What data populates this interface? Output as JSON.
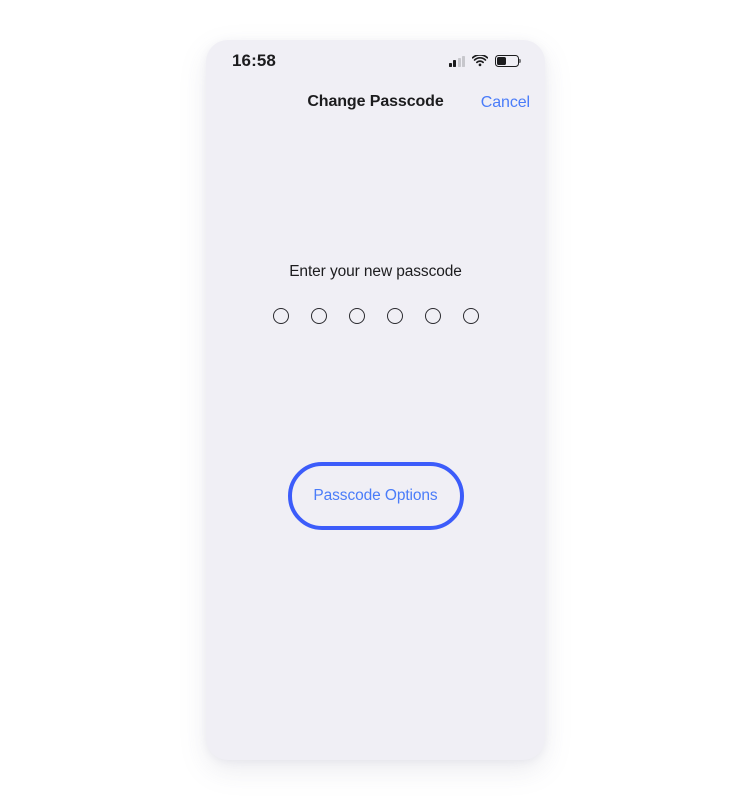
{
  "screen": {
    "background_color": "#ffffff",
    "panel_color": "#f0eff5"
  },
  "status_bar": {
    "time": "16:58",
    "cellular": {
      "icon": "cellular-signal-icon",
      "bars_total": 4,
      "bars_active": 2
    },
    "wifi": {
      "icon": "wifi-icon",
      "strength": "full"
    },
    "battery": {
      "icon": "battery-icon",
      "level_percent": 45
    }
  },
  "nav_bar": {
    "title": "Change Passcode",
    "cancel_label": "Cancel",
    "cancel_color": "#4a7cf9"
  },
  "passcode": {
    "prompt": "Enter your new passcode",
    "dot_count": 6,
    "dots_filled": 0
  },
  "options_button": {
    "label": "Passcode Options",
    "border_color": "#3c5cfa",
    "text_color": "#4a7cf9"
  }
}
